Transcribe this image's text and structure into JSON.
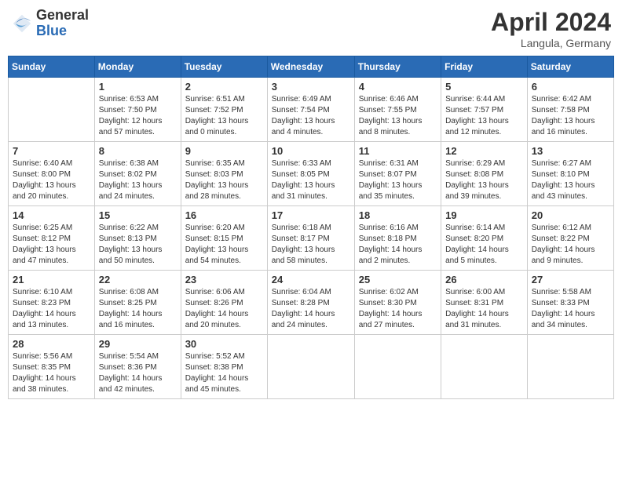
{
  "header": {
    "logo_general": "General",
    "logo_blue": "Blue",
    "month_title": "April 2024",
    "location": "Langula, Germany"
  },
  "days_of_week": [
    "Sunday",
    "Monday",
    "Tuesday",
    "Wednesday",
    "Thursday",
    "Friday",
    "Saturday"
  ],
  "weeks": [
    [
      {
        "day": "",
        "sunrise": "",
        "sunset": "",
        "daylight": ""
      },
      {
        "day": "1",
        "sunrise": "Sunrise: 6:53 AM",
        "sunset": "Sunset: 7:50 PM",
        "daylight": "Daylight: 12 hours and 57 minutes."
      },
      {
        "day": "2",
        "sunrise": "Sunrise: 6:51 AM",
        "sunset": "Sunset: 7:52 PM",
        "daylight": "Daylight: 13 hours and 0 minutes."
      },
      {
        "day": "3",
        "sunrise": "Sunrise: 6:49 AM",
        "sunset": "Sunset: 7:54 PM",
        "daylight": "Daylight: 13 hours and 4 minutes."
      },
      {
        "day": "4",
        "sunrise": "Sunrise: 6:46 AM",
        "sunset": "Sunset: 7:55 PM",
        "daylight": "Daylight: 13 hours and 8 minutes."
      },
      {
        "day": "5",
        "sunrise": "Sunrise: 6:44 AM",
        "sunset": "Sunset: 7:57 PM",
        "daylight": "Daylight: 13 hours and 12 minutes."
      },
      {
        "day": "6",
        "sunrise": "Sunrise: 6:42 AM",
        "sunset": "Sunset: 7:58 PM",
        "daylight": "Daylight: 13 hours and 16 minutes."
      }
    ],
    [
      {
        "day": "7",
        "sunrise": "Sunrise: 6:40 AM",
        "sunset": "Sunset: 8:00 PM",
        "daylight": "Daylight: 13 hours and 20 minutes."
      },
      {
        "day": "8",
        "sunrise": "Sunrise: 6:38 AM",
        "sunset": "Sunset: 8:02 PM",
        "daylight": "Daylight: 13 hours and 24 minutes."
      },
      {
        "day": "9",
        "sunrise": "Sunrise: 6:35 AM",
        "sunset": "Sunset: 8:03 PM",
        "daylight": "Daylight: 13 hours and 28 minutes."
      },
      {
        "day": "10",
        "sunrise": "Sunrise: 6:33 AM",
        "sunset": "Sunset: 8:05 PM",
        "daylight": "Daylight: 13 hours and 31 minutes."
      },
      {
        "day": "11",
        "sunrise": "Sunrise: 6:31 AM",
        "sunset": "Sunset: 8:07 PM",
        "daylight": "Daylight: 13 hours and 35 minutes."
      },
      {
        "day": "12",
        "sunrise": "Sunrise: 6:29 AM",
        "sunset": "Sunset: 8:08 PM",
        "daylight": "Daylight: 13 hours and 39 minutes."
      },
      {
        "day": "13",
        "sunrise": "Sunrise: 6:27 AM",
        "sunset": "Sunset: 8:10 PM",
        "daylight": "Daylight: 13 hours and 43 minutes."
      }
    ],
    [
      {
        "day": "14",
        "sunrise": "Sunrise: 6:25 AM",
        "sunset": "Sunset: 8:12 PM",
        "daylight": "Daylight: 13 hours and 47 minutes."
      },
      {
        "day": "15",
        "sunrise": "Sunrise: 6:22 AM",
        "sunset": "Sunset: 8:13 PM",
        "daylight": "Daylight: 13 hours and 50 minutes."
      },
      {
        "day": "16",
        "sunrise": "Sunrise: 6:20 AM",
        "sunset": "Sunset: 8:15 PM",
        "daylight": "Daylight: 13 hours and 54 minutes."
      },
      {
        "day": "17",
        "sunrise": "Sunrise: 6:18 AM",
        "sunset": "Sunset: 8:17 PM",
        "daylight": "Daylight: 13 hours and 58 minutes."
      },
      {
        "day": "18",
        "sunrise": "Sunrise: 6:16 AM",
        "sunset": "Sunset: 8:18 PM",
        "daylight": "Daylight: 14 hours and 2 minutes."
      },
      {
        "day": "19",
        "sunrise": "Sunrise: 6:14 AM",
        "sunset": "Sunset: 8:20 PM",
        "daylight": "Daylight: 14 hours and 5 minutes."
      },
      {
        "day": "20",
        "sunrise": "Sunrise: 6:12 AM",
        "sunset": "Sunset: 8:22 PM",
        "daylight": "Daylight: 14 hours and 9 minutes."
      }
    ],
    [
      {
        "day": "21",
        "sunrise": "Sunrise: 6:10 AM",
        "sunset": "Sunset: 8:23 PM",
        "daylight": "Daylight: 14 hours and 13 minutes."
      },
      {
        "day": "22",
        "sunrise": "Sunrise: 6:08 AM",
        "sunset": "Sunset: 8:25 PM",
        "daylight": "Daylight: 14 hours and 16 minutes."
      },
      {
        "day": "23",
        "sunrise": "Sunrise: 6:06 AM",
        "sunset": "Sunset: 8:26 PM",
        "daylight": "Daylight: 14 hours and 20 minutes."
      },
      {
        "day": "24",
        "sunrise": "Sunrise: 6:04 AM",
        "sunset": "Sunset: 8:28 PM",
        "daylight": "Daylight: 14 hours and 24 minutes."
      },
      {
        "day": "25",
        "sunrise": "Sunrise: 6:02 AM",
        "sunset": "Sunset: 8:30 PM",
        "daylight": "Daylight: 14 hours and 27 minutes."
      },
      {
        "day": "26",
        "sunrise": "Sunrise: 6:00 AM",
        "sunset": "Sunset: 8:31 PM",
        "daylight": "Daylight: 14 hours and 31 minutes."
      },
      {
        "day": "27",
        "sunrise": "Sunrise: 5:58 AM",
        "sunset": "Sunset: 8:33 PM",
        "daylight": "Daylight: 14 hours and 34 minutes."
      }
    ],
    [
      {
        "day": "28",
        "sunrise": "Sunrise: 5:56 AM",
        "sunset": "Sunset: 8:35 PM",
        "daylight": "Daylight: 14 hours and 38 minutes."
      },
      {
        "day": "29",
        "sunrise": "Sunrise: 5:54 AM",
        "sunset": "Sunset: 8:36 PM",
        "daylight": "Daylight: 14 hours and 42 minutes."
      },
      {
        "day": "30",
        "sunrise": "Sunrise: 5:52 AM",
        "sunset": "Sunset: 8:38 PM",
        "daylight": "Daylight: 14 hours and 45 minutes."
      },
      {
        "day": "",
        "sunrise": "",
        "sunset": "",
        "daylight": ""
      },
      {
        "day": "",
        "sunrise": "",
        "sunset": "",
        "daylight": ""
      },
      {
        "day": "",
        "sunrise": "",
        "sunset": "",
        "daylight": ""
      },
      {
        "day": "",
        "sunrise": "",
        "sunset": "",
        "daylight": ""
      }
    ]
  ]
}
